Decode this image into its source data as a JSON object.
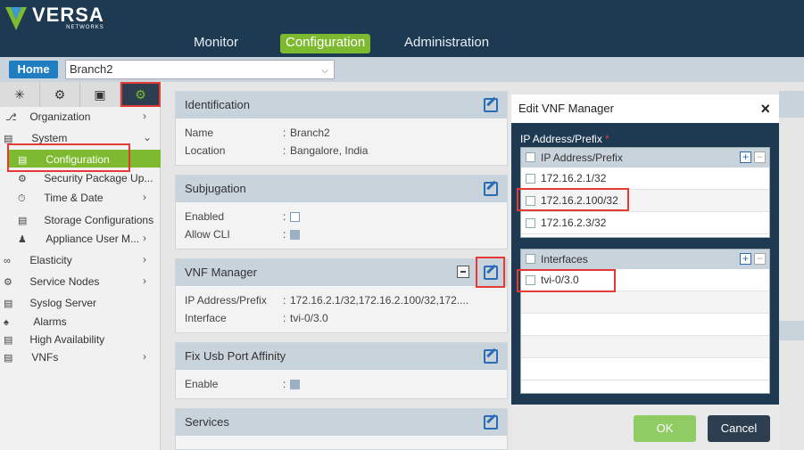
{
  "header": {
    "logo": {
      "title": "VERSA",
      "subtitle": "NETWORKS"
    },
    "nav": [
      {
        "label": "Monitor"
      },
      {
        "label": "Configuration",
        "active": true
      },
      {
        "label": "Administration"
      }
    ]
  },
  "subbar": {
    "home_label": "Home",
    "appliance_value": "Branch2"
  },
  "sidebar": {
    "icon_tabs": [
      "network-icon",
      "gear-icon",
      "cube-icon",
      "settings-badge-icon"
    ],
    "items": [
      {
        "label": "Organization",
        "icon": "org-icon"
      },
      {
        "label": "System",
        "icon": "system-icon"
      },
      {
        "label": "Configuration",
        "icon": "config-icon",
        "selected": true
      },
      {
        "label": "Security Package Up...",
        "icon": "package-icon"
      },
      {
        "label": "Time & Date",
        "icon": "clock-icon"
      },
      {
        "label": "Storage Configurations",
        "icon": "storage-icon"
      },
      {
        "label": "Appliance User M...",
        "icon": "users-icon"
      },
      {
        "label": "Elasticity",
        "icon": "elasticity-icon"
      },
      {
        "label": "Service Nodes",
        "icon": "nodes-icon"
      },
      {
        "label": "Syslog Server",
        "icon": "server-icon"
      },
      {
        "label": "Alarms",
        "icon": "alarm-icon"
      },
      {
        "label": "High Availability",
        "icon": "ha-icon"
      },
      {
        "label": "VNFs",
        "icon": "vnf-icon"
      }
    ]
  },
  "panels": {
    "identification": {
      "title": "Identification",
      "rows": [
        {
          "label": "Name",
          "value": "Branch2"
        },
        {
          "label": "Location",
          "value": "Bangalore, India"
        }
      ]
    },
    "subjugation": {
      "title": "Subjugation",
      "rows": [
        {
          "label": "Enabled"
        },
        {
          "label": "Allow CLI"
        }
      ]
    },
    "vnf_manager": {
      "title": "VNF Manager",
      "rows": [
        {
          "label": "IP Address/Prefix",
          "value": "172.16.2.1/32,172.16.2.100/32,172...."
        },
        {
          "label": "Interface",
          "value": "tvi-0/3.0"
        }
      ]
    },
    "fix_usb": {
      "title": "Fix Usb Port Affinity",
      "rows": [
        {
          "label": "Enable"
        }
      ]
    },
    "services": {
      "title": "Services"
    }
  },
  "colon": ":",
  "modal": {
    "title": "Edit VNF Manager",
    "close": "×",
    "field_label": "IP Address/Prefix",
    "required_mark": "*",
    "ip_grid": {
      "header": "IP Address/Prefix",
      "rows": [
        "172.16.2.1/32",
        "172.16.2.100/32",
        "172.16.2.3/32"
      ]
    },
    "iface_grid": {
      "header": "Interfaces",
      "rows": [
        "tvi-0/3.0"
      ]
    },
    "plus": "+",
    "minus": "−",
    "ok_label": "OK",
    "cancel_label": "Cancel"
  },
  "colors": {
    "header_bg": "#1e3a52",
    "accent_green": "#7dba2f",
    "primary_blue": "#1f7dc0",
    "highlight_red": "#e53935"
  }
}
